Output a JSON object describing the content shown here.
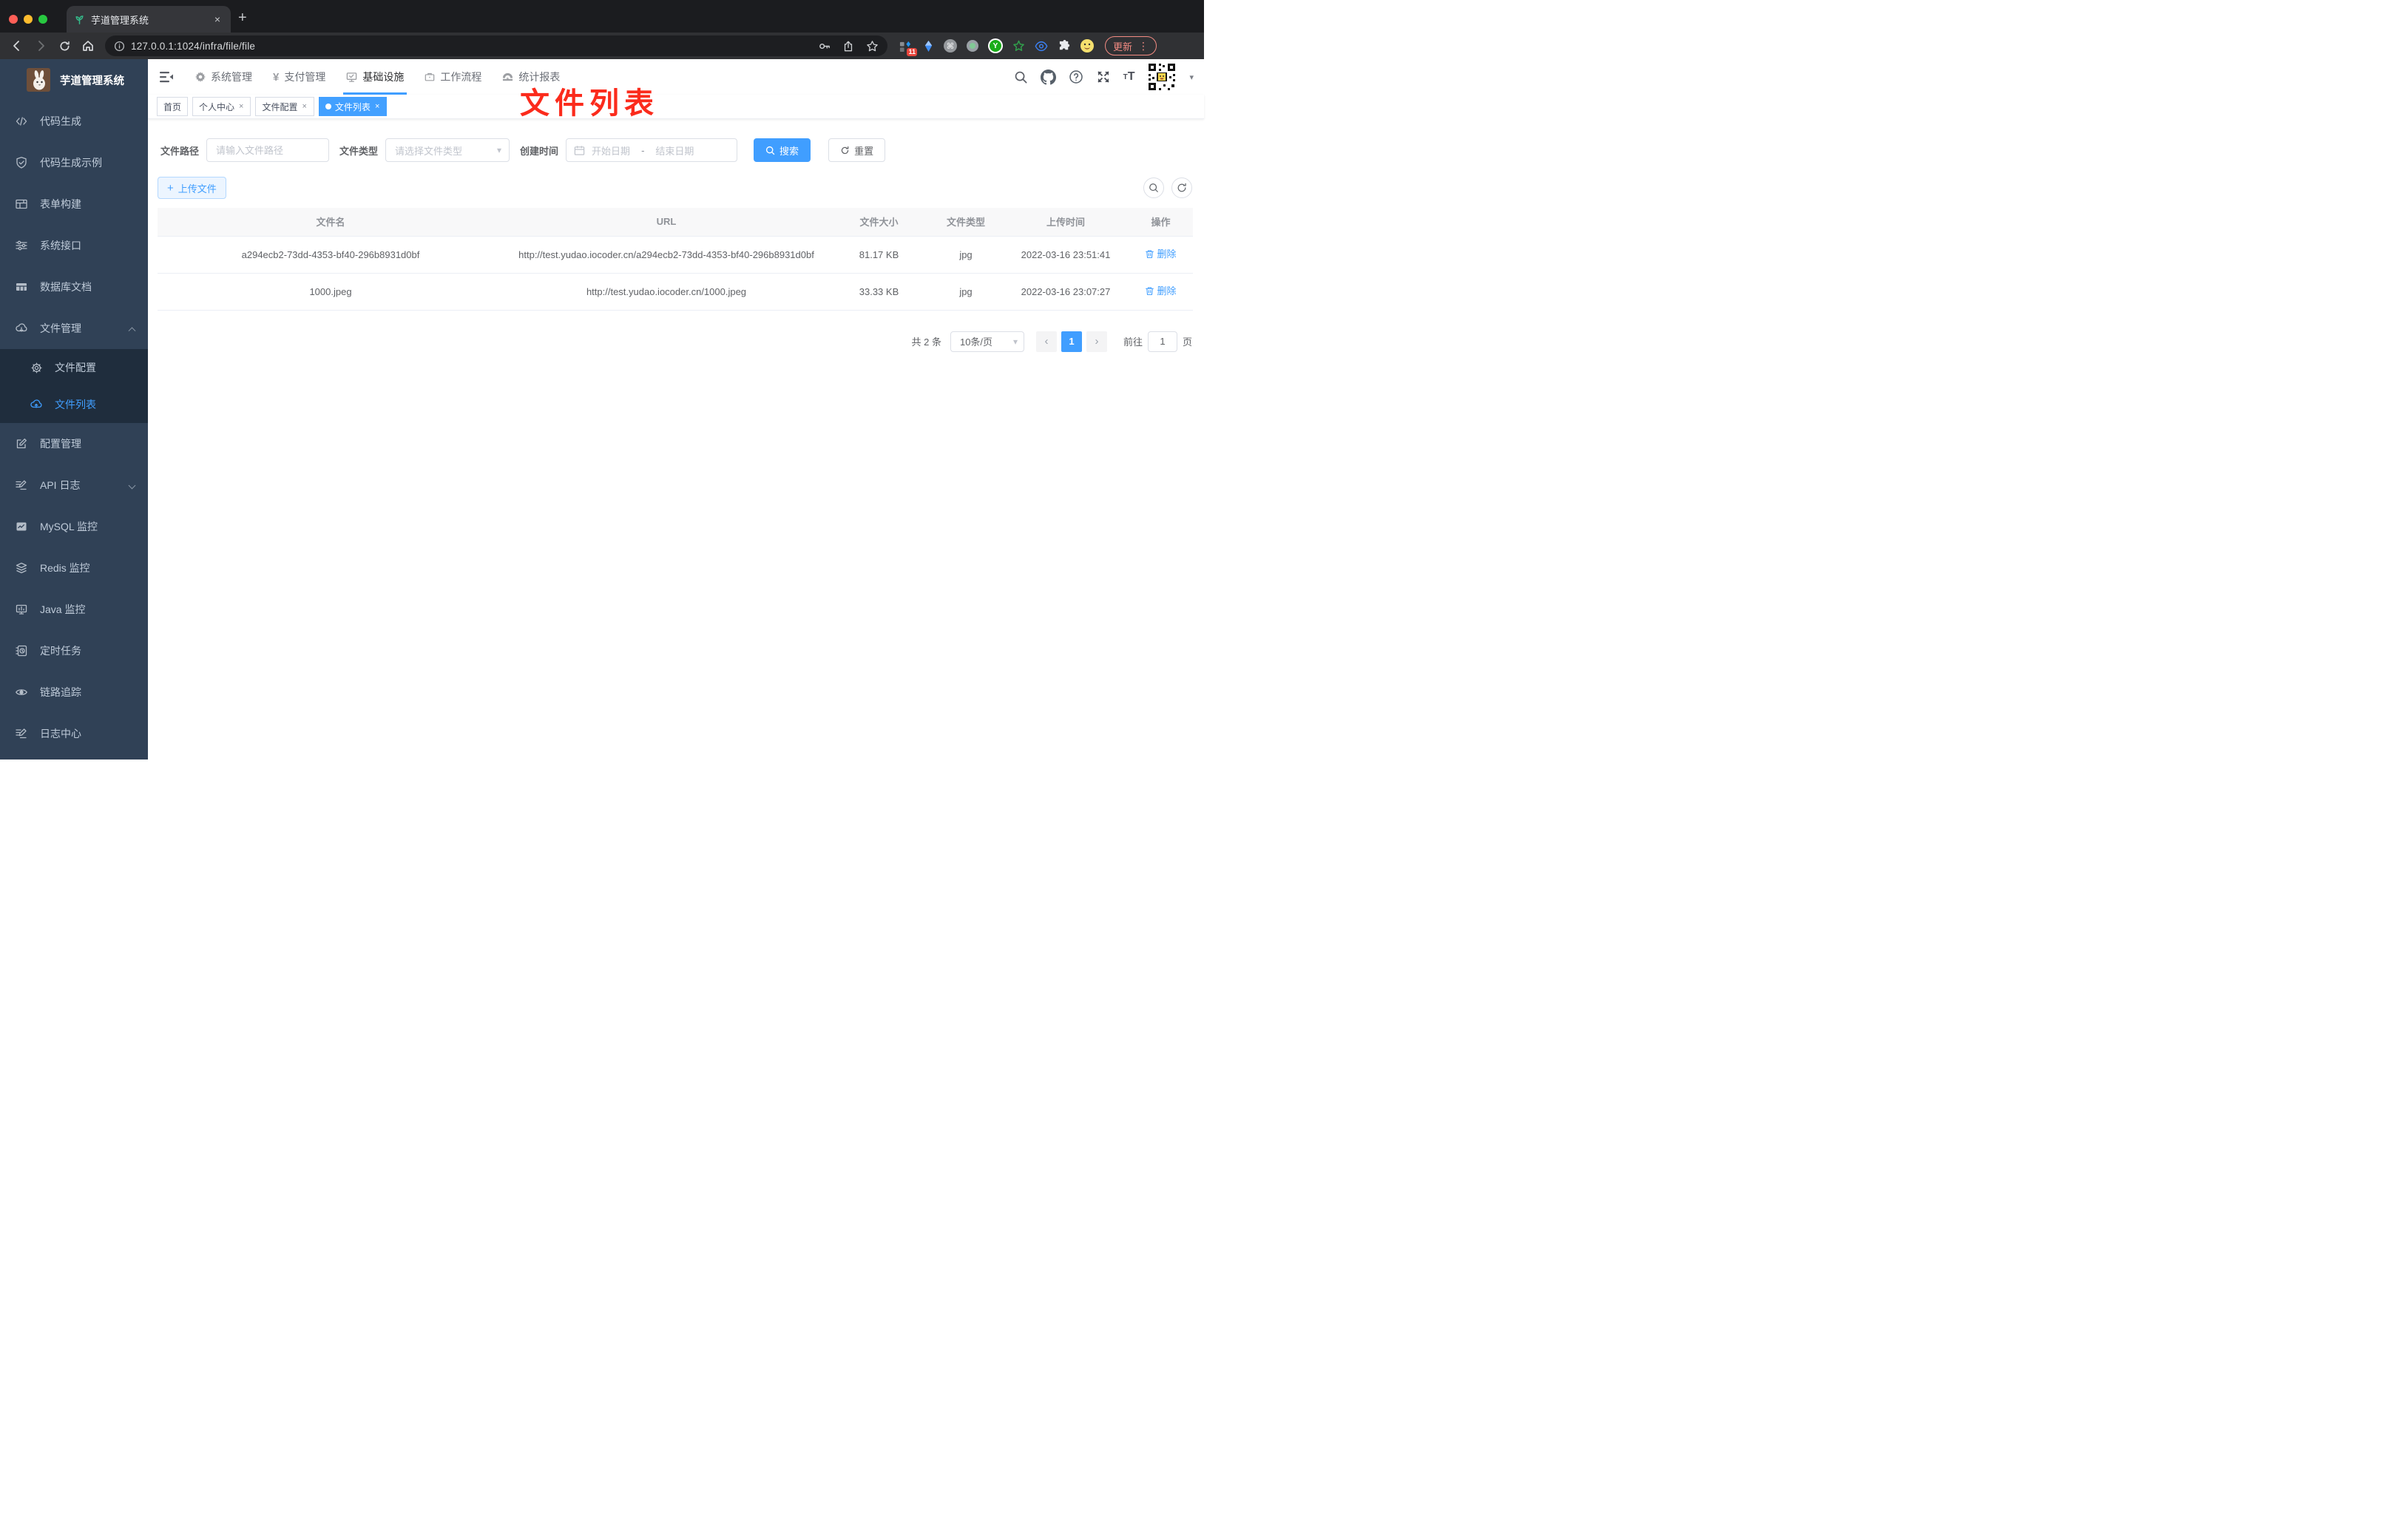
{
  "icons": {
    "close": "×",
    "plus": "+",
    "more": "⋮",
    "prev": "‹",
    "next": "›",
    "caret_down": "▾",
    "named": [
      "favicon-sprout-icon",
      "back-icon",
      "forward-icon",
      "reload-icon",
      "home-icon",
      "info-icon",
      "key-icon",
      "share-icon",
      "star-icon",
      "extension-grid-icon",
      "kite-icon",
      "command-icon",
      "record-icon",
      "y-circle-icon",
      "green-star-icon",
      "eye-blue-icon",
      "puzzle-icon",
      "emoji-icon",
      "search-icon",
      "github-icon",
      "help-icon",
      "fullscreen-icon",
      "font-size-icon",
      "qr-avatar",
      "calendar-icon",
      "refresh-icon",
      "trash-icon",
      "magnifier-icon"
    ]
  },
  "colors": {
    "accent": "#409eff",
    "annotation_red": "#fb2b1c",
    "sidebar_bg": "#304156",
    "submenu_bg": "#1f2d3d",
    "sidebar_text": "#bfcbd9",
    "update_pill": "#f28b82",
    "tag_active_bg": "#42a0ff"
  },
  "browser": {
    "tab_title": "芋道管理系统",
    "url": "127.0.0.1:1024/infra/file/file",
    "ext_badge": "11",
    "update_label": "更新"
  },
  "nav": {
    "items": [
      "系统管理",
      "支付管理",
      "基础设施",
      "工作流程",
      "统计报表"
    ],
    "active": "基础设施"
  },
  "sidebar": {
    "logo_title": "芋道管理系统",
    "items_top": [
      "代码生成",
      "代码生成示例",
      "表单构建",
      "系统接口",
      "数据库文档"
    ],
    "group_label": "文件管理",
    "sub": [
      "文件配置",
      "文件列表"
    ],
    "active_item": "文件列表",
    "items_bottom": [
      "配置管理",
      "API 日志",
      "MySQL 监控",
      "Redis 监控",
      "Java 监控",
      "定时任务",
      "链路追踪",
      "日志中心"
    ]
  },
  "tabs": [
    {
      "label": "首页",
      "closable": false,
      "active": false
    },
    {
      "label": "个人中心",
      "closable": true,
      "active": false
    },
    {
      "label": "文件配置",
      "closable": true,
      "active": false
    },
    {
      "label": "文件列表",
      "closable": true,
      "active": true
    }
  ],
  "annotation": "文件列表",
  "filters": {
    "path_label": "文件路径",
    "path_placeholder": "请输入文件路径",
    "type_label": "文件类型",
    "type_placeholder": "请选择文件类型",
    "date_label": "创建时间",
    "start_placeholder": "开始日期",
    "sep": "-",
    "end_placeholder": "结束日期",
    "search_label": "搜索",
    "reset_label": "重置"
  },
  "toolbar": {
    "upload_label": "上传文件"
  },
  "table": {
    "columns": [
      "文件名",
      "URL",
      "文件大小",
      "文件类型",
      "上传时间",
      "操作"
    ],
    "rows": [
      {
        "name": "a294ecb2-73dd-4353-bf40-296b8931d0bf",
        "url": "http://test.yudao.iocoder.cn/a294ecb2-73dd-4353-bf40-296b8931d0bf",
        "size": "81.17 KB",
        "type": "jpg",
        "time": "2022-03-16 23:51:41",
        "action": "删除"
      },
      {
        "name": "1000.jpeg",
        "url": "http://test.yudao.iocoder.cn/1000.jpeg",
        "size": "33.33 KB",
        "type": "jpg",
        "time": "2022-03-16 23:07:27",
        "action": "删除"
      }
    ]
  },
  "pagination": {
    "total": "共 2 条",
    "page_size": "10条/页",
    "page": "1",
    "goto_label": "前往",
    "goto_value": "1",
    "unit_label": "页"
  }
}
